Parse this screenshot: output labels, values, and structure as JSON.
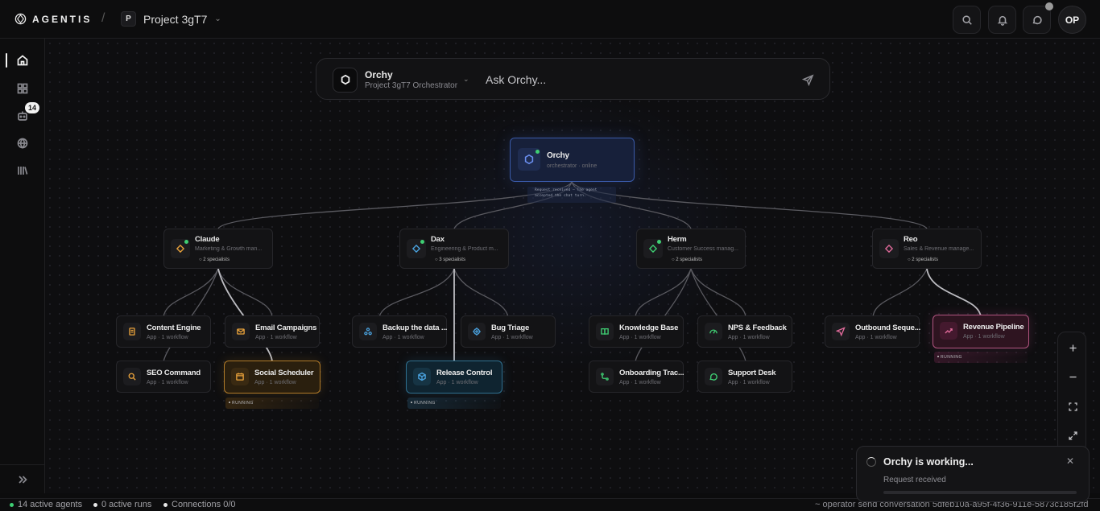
{
  "app": {
    "brand": "AGENTIS",
    "project_initial": "P",
    "project_name": "Project 3gT7"
  },
  "header": {
    "avatar_initials": "OP"
  },
  "sidebar": {
    "badge_count": "14"
  },
  "askbar": {
    "orchestrator_name": "Orchy",
    "orchestrator_sub": "Project 3gT7 Orchestrator",
    "placeholder": "Ask Orchy..."
  },
  "graph": {
    "root": {
      "name": "Orchy",
      "sub": "orchestrator · online",
      "note": "Request received – The agent accepted the chat turn."
    },
    "agents": [
      {
        "name": "Claude",
        "sub": "Marketing & Growth man...",
        "specialists": "2 specialists",
        "color": "#e9a23b"
      },
      {
        "name": "Dax",
        "sub": "Engineering & Product m...",
        "specialists": "3 specialists",
        "color": "#4aa3e0"
      },
      {
        "name": "Herm",
        "sub": "Customer Success manag...",
        "specialists": "2 specialists",
        "color": "#3fcf73"
      },
      {
        "name": "Reo",
        "sub": "Sales & Revenue manage...",
        "specialists": "2 specialists",
        "color": "#e06a9a"
      }
    ],
    "apps": [
      {
        "name": "Content Engine",
        "sub": "App · 1 workflow",
        "icon": "document-icon",
        "color": "#e9a23b"
      },
      {
        "name": "Email Campaigns",
        "sub": "App · 1 workflow",
        "icon": "mail-icon",
        "color": "#e9a23b"
      },
      {
        "name": "SEO Command",
        "sub": "App · 1 workflow",
        "icon": "search-icon",
        "color": "#e9a23b"
      },
      {
        "name": "Social Scheduler",
        "sub": "App · 1 workflow",
        "icon": "calendar-icon",
        "color": "#e9a23b",
        "running": "RUNNING"
      },
      {
        "name": "Backup the data ...",
        "sub": "App · 1 workflow",
        "icon": "nodes-icon",
        "color": "#4aa3e0"
      },
      {
        "name": "Bug Triage",
        "sub": "App · 1 workflow",
        "icon": "target-icon",
        "color": "#4aa3e0"
      },
      {
        "name": "Release Control",
        "sub": "App · 1 workflow",
        "icon": "box-icon",
        "color": "#4aa3e0",
        "running": "RUNNING"
      },
      {
        "name": "Knowledge Base",
        "sub": "App · 1 workflow",
        "icon": "book-icon",
        "color": "#3fcf73"
      },
      {
        "name": "NPS & Feedback",
        "sub": "App · 1 workflow",
        "icon": "gauge-icon",
        "color": "#3fcf73"
      },
      {
        "name": "Onboarding Trac...",
        "sub": "App · 1 workflow",
        "icon": "route-icon",
        "color": "#3fcf73"
      },
      {
        "name": "Support Desk",
        "sub": "App · 1 workflow",
        "icon": "chat-icon",
        "color": "#3fcf73"
      },
      {
        "name": "Outbound Seque...",
        "sub": "App · 1 workflow",
        "icon": "send-icon",
        "color": "#e06a9a"
      },
      {
        "name": "Revenue Pipeline",
        "sub": "App · 1 workflow",
        "icon": "trend-icon",
        "color": "#e06a9a",
        "running": "RUNNING"
      }
    ]
  },
  "toast": {
    "title": "Orchy is working...",
    "subtitle": "Request received"
  },
  "statusbar": {
    "active_agents": "14 active agents",
    "active_runs": "0 active runs",
    "connections": "Connections 0/0",
    "right_text": "~ operator send conversation 5dfeb10a-a95f-4f36-911e-5873c185f2fd"
  },
  "colors": {
    "online": "#3fcf73",
    "root_border": "#3a5aa8"
  }
}
